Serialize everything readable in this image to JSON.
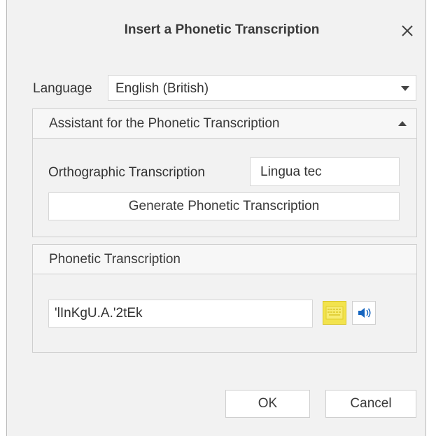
{
  "dialog": {
    "title": "Insert a Phonetic Transcription",
    "close_icon": "close-icon"
  },
  "language": {
    "label": "Language",
    "selected": "English (British)"
  },
  "assistant": {
    "header": "Assistant for the Phonetic Transcription",
    "ortho_label": "Orthographic Transcription",
    "ortho_value": "Lingua tec",
    "generate_label": "Generate Phonetic Transcription"
  },
  "phonetic": {
    "header": "Phonetic Transcription",
    "value": "'lInKgU.A.'2tEk",
    "keyboard_icon": "keyboard-icon",
    "speaker_icon": "speaker-icon",
    "keyboard_color": "#f2e34d",
    "speaker_color": "#1565c0"
  },
  "buttons": {
    "ok": "OK",
    "cancel": "Cancel"
  }
}
